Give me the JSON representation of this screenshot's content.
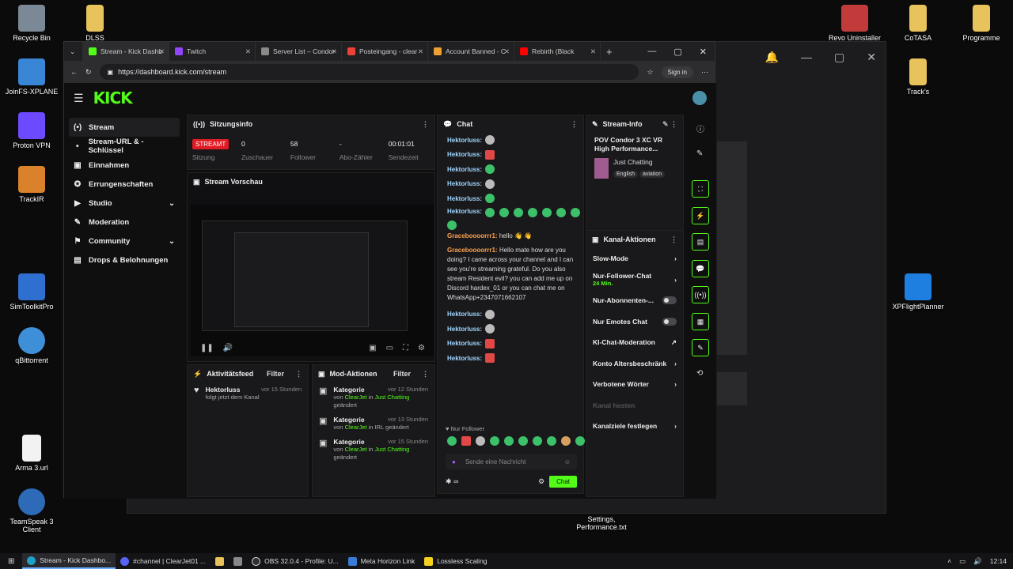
{
  "desktop": {
    "icons_left": [
      "Recycle Bin",
      "JoinFS-XPLANE",
      "Proton VPN",
      "TrackIR",
      "SimToolkitPro",
      "qBittorrent",
      "Arma 3.url",
      "TeamSpeak 3 Client"
    ],
    "icons_top": [
      "DLSS",
      "Revo Uninstaller",
      "CoTASA",
      "Programme"
    ],
    "icons_right": [
      "Track's",
      "XPFlightPlanner"
    ],
    "file_label": "Settings, Performance.txt"
  },
  "browser": {
    "tabs": [
      {
        "label": "Stream - Kick Dashb",
        "color": "#53fc18",
        "active": true
      },
      {
        "label": "Twitch",
        "color": "#9146ff"
      },
      {
        "label": "Server List – Condor",
        "color": "#8a8a8a"
      },
      {
        "label": "Posteingang - clear",
        "color": "#ea4335"
      },
      {
        "label": "Account Banned - C",
        "color": "#f0a030"
      },
      {
        "label": "Rebirth (Black",
        "color": "#ff0000"
      }
    ],
    "url": "https://dashboard.kick.com/stream",
    "signin": "Sign in"
  },
  "kick": {
    "logo": "KICK",
    "sidebar": [
      {
        "label": "Stream",
        "icon": "(•)",
        "active": true
      },
      {
        "label": "Stream-URL & -Schlüssel",
        "icon": "•"
      },
      {
        "label": "Einnahmen",
        "icon": "▣"
      },
      {
        "label": "Errungenschaften",
        "icon": "✪"
      },
      {
        "label": "Studio",
        "icon": "▶",
        "chev": "⌄"
      },
      {
        "label": "Moderation",
        "icon": "✎"
      },
      {
        "label": "Community",
        "icon": "⚑",
        "chev": "⌄"
      },
      {
        "label": "Drops & Belohnungen",
        "icon": "▤"
      }
    ],
    "session": {
      "title": "Sitzungsinfo",
      "live": "STREAMT",
      "stats": [
        {
          "value": "0",
          "label": "Zuschauer"
        },
        {
          "value": "58",
          "label": "Follower"
        },
        {
          "value": "-",
          "label": "Abo-Zähler"
        },
        {
          "value": "00:01:01",
          "label": "Sendezeit"
        }
      ],
      "first_label": "Sitzung"
    },
    "preview": {
      "title": "Stream Vorschau"
    },
    "chat": {
      "title": "Chat",
      "user": "Hektorluss:",
      "msg1_user": "Graceboooorrr1:",
      "msg1_text": "hello 👋 👋",
      "msg2_user": "Graceboooorrr1:",
      "msg2_text": "Hello mate how are you doing? I came across your channel and I can see you're streaming grateful. Do you also stream Resident evil? you can add me up on Discord hardex_01 or you can chat me on WhatsApp+2347071662107",
      "follower_only": "Nur Follower",
      "placeholder": "Sende eine Nachricht",
      "send": "Chat"
    },
    "stream_info": {
      "title": "Stream-Info",
      "stream_title": "POV Condor 3 XC VR High Performance...",
      "category": "Just Chatting",
      "tags": [
        "English",
        "aviation"
      ]
    },
    "channel_actions": {
      "title": "Kanal-Aktionen",
      "rows": [
        {
          "label": "Slow-Mode",
          "right": "›"
        },
        {
          "label": "Nur-Follower-Chat",
          "sub": "24 Min.",
          "right": "›"
        },
        {
          "label": "Nur-Abonnenten-...",
          "toggle": true
        },
        {
          "label": "Nur Emotes Chat",
          "toggle": true
        },
        {
          "label": "KI-Chat-Moderation",
          "right": "↗"
        },
        {
          "label": "Konto Altersbeschränk",
          "right": "›"
        },
        {
          "label": "Verbotene Wörter",
          "right": "›"
        },
        {
          "label": "Kanal hosten",
          "disabled": true
        },
        {
          "label": "Kanalziele festlegen",
          "right": "›"
        }
      ]
    },
    "activity": {
      "title": "Aktivitätsfeed",
      "filter": "Filter",
      "item_user": "Hektorluss",
      "item_time": "vor 15 Stunden",
      "item_text": "folgt jetzt dem Kanal"
    },
    "mod": {
      "title": "Mod-Aktionen",
      "filter": "Filter",
      "items": [
        {
          "title": "Kategorie",
          "time": "vor 12 Stunden",
          "by": "von ",
          "user": "ClearJet",
          "in": " in ",
          "cat": "Just Chatting",
          "changed": "geändert",
          "cat_green": true
        },
        {
          "title": "Kategorie",
          "time": "vor 13 Stunden",
          "by": "von ",
          "user": "ClearJet",
          "in": " in ",
          "cat": "IRL",
          "changed": "geändert",
          "cat_green": false
        },
        {
          "title": "Kategorie",
          "time": "vor 15 Stunden",
          "by": "von ",
          "user": "ClearJet",
          "in": " in ",
          "cat": "Just Chatting",
          "changed": "geändert",
          "cat_green": true
        }
      ]
    }
  },
  "taskbar": {
    "items": [
      "Stream - Kick Dashbo...",
      "#channel | ClearJet01 ...",
      "OBS 32.0.4 - Profile: U...",
      "Meta Horizon Link",
      "Lossless Scaling"
    ],
    "time": "12:14"
  }
}
